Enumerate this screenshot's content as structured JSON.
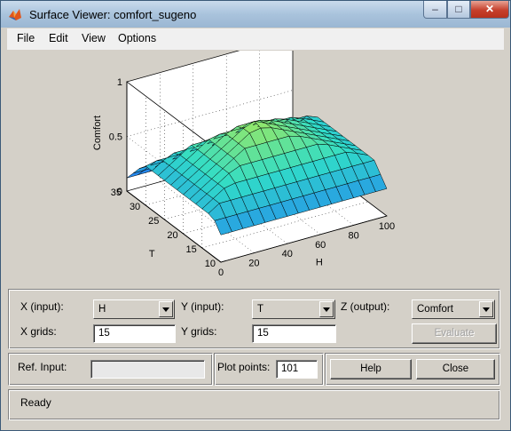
{
  "window": {
    "title": "Surface Viewer: comfort_sugeno"
  },
  "menu": [
    "File",
    "Edit",
    "View",
    "Options"
  ],
  "plot": {
    "z_label": "Comfort",
    "x_label": "H",
    "y_label": "T",
    "z_ticks": [
      "0",
      "0.5",
      "1"
    ],
    "x_ticks": [
      "0",
      "20",
      "40",
      "60",
      "80",
      "100"
    ],
    "y_ticks": [
      "10",
      "15",
      "20",
      "25",
      "30",
      "35"
    ]
  },
  "controls": {
    "x_input_label": "X (input):",
    "x_input_value": "H",
    "y_input_label": "Y (input):",
    "y_input_value": "T",
    "z_output_label": "Z (output):",
    "z_output_value": "Comfort",
    "x_grids_label": "X grids:",
    "x_grids_value": "15",
    "y_grids_label": "Y grids:",
    "y_grids_value": "15",
    "evaluate_label": "Evaluate",
    "ref_input_label": "Ref. Input:",
    "ref_input_value": "",
    "plot_points_label": "Plot points:",
    "plot_points_value": "101",
    "help_label": "Help",
    "close_label": "Close",
    "status": "Ready"
  },
  "colors": {
    "surface_low": "#2060ff",
    "surface_mid": "#30e0c0",
    "surface_high": "#e0f020"
  }
}
